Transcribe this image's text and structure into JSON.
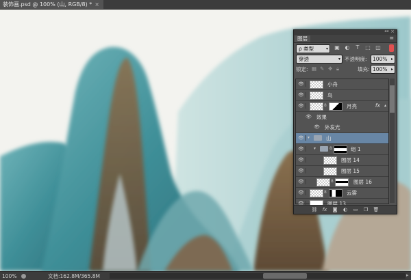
{
  "document_tab": {
    "title": "装饰画.psd @ 100% (山, RGB/8) *",
    "close": "×"
  },
  "status": {
    "zoom": "100%",
    "doc_info": "文档:162.8M/365.8M",
    "arrow": "▶"
  },
  "layers_panel": {
    "tab": "图层",
    "menu_icon": "≡",
    "filter_kind": "ρ 类型",
    "filter_icons": [
      "image-icon",
      "adjustment-icon",
      "type-icon",
      "shape-icon",
      "smart-object-icon"
    ],
    "blend_mode": "穿透",
    "opacity_label": "不透明度:",
    "opacity_value": "100%",
    "lock_label": "锁定:",
    "fill_label": "填充:",
    "fill_value": "100%",
    "layers": [
      {
        "name": "小舟",
        "type": "layer"
      },
      {
        "name": "鸟",
        "type": "layer"
      },
      {
        "name": "月亮",
        "type": "layer-mask",
        "fx": "fx"
      },
      {
        "name": "效果",
        "type": "effects"
      },
      {
        "name": "外发光",
        "type": "effect"
      },
      {
        "name": "山",
        "type": "group",
        "selected": true
      },
      {
        "name": "组 1",
        "type": "subgroup"
      },
      {
        "name": "图层 14",
        "type": "nested"
      },
      {
        "name": "图层 15",
        "type": "nested"
      },
      {
        "name": "图层 16",
        "type": "layer-mask"
      },
      {
        "name": "云雾",
        "type": "layer-mask"
      },
      {
        "name": "图层 13",
        "type": "layer"
      }
    ],
    "bottom_icons": [
      "link-icon",
      "fx-icon",
      "mask-icon",
      "adjustment-icon",
      "folder-icon",
      "new-layer-icon",
      "trash-icon"
    ]
  },
  "colors": {
    "accent_selected": "#6886a5",
    "panel_bg": "#535353",
    "mountain_teal": "#3f8f98",
    "mountain_brown": "#7a6244"
  }
}
